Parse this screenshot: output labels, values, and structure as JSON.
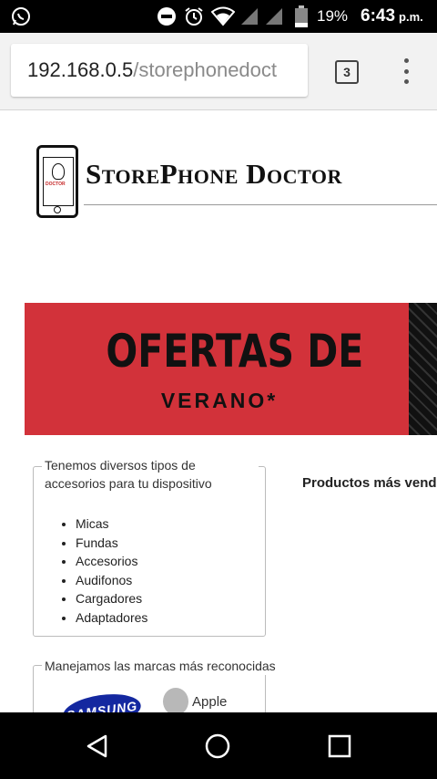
{
  "status_bar": {
    "battery": "19%",
    "time": "6:43",
    "ampm": "p.m."
  },
  "browser": {
    "url_host": "192.168.0.5",
    "url_path": "/storephonedoct",
    "tab_count": "3"
  },
  "site": {
    "logo_title": "StorePhone Doctor",
    "logo_badge_text": "DOCTOR",
    "banner": {
      "title": "OFERTAS DE",
      "subtitle": "VERANO*",
      "color": "#d2323a"
    },
    "accessories": {
      "legend": "Tenemos diversos tipos de accesorios para tu dispositivo",
      "items": [
        "Micas",
        "Fundas",
        "Accesorios",
        "Audifonos",
        "Cargadores",
        "Adaptadores"
      ]
    },
    "brands": {
      "legend": "Manejamos las marcas más reconocidas",
      "logos": [
        "SAMSUNG",
        "Apple"
      ]
    },
    "best_sellers_heading": "Productos más vendidos"
  }
}
